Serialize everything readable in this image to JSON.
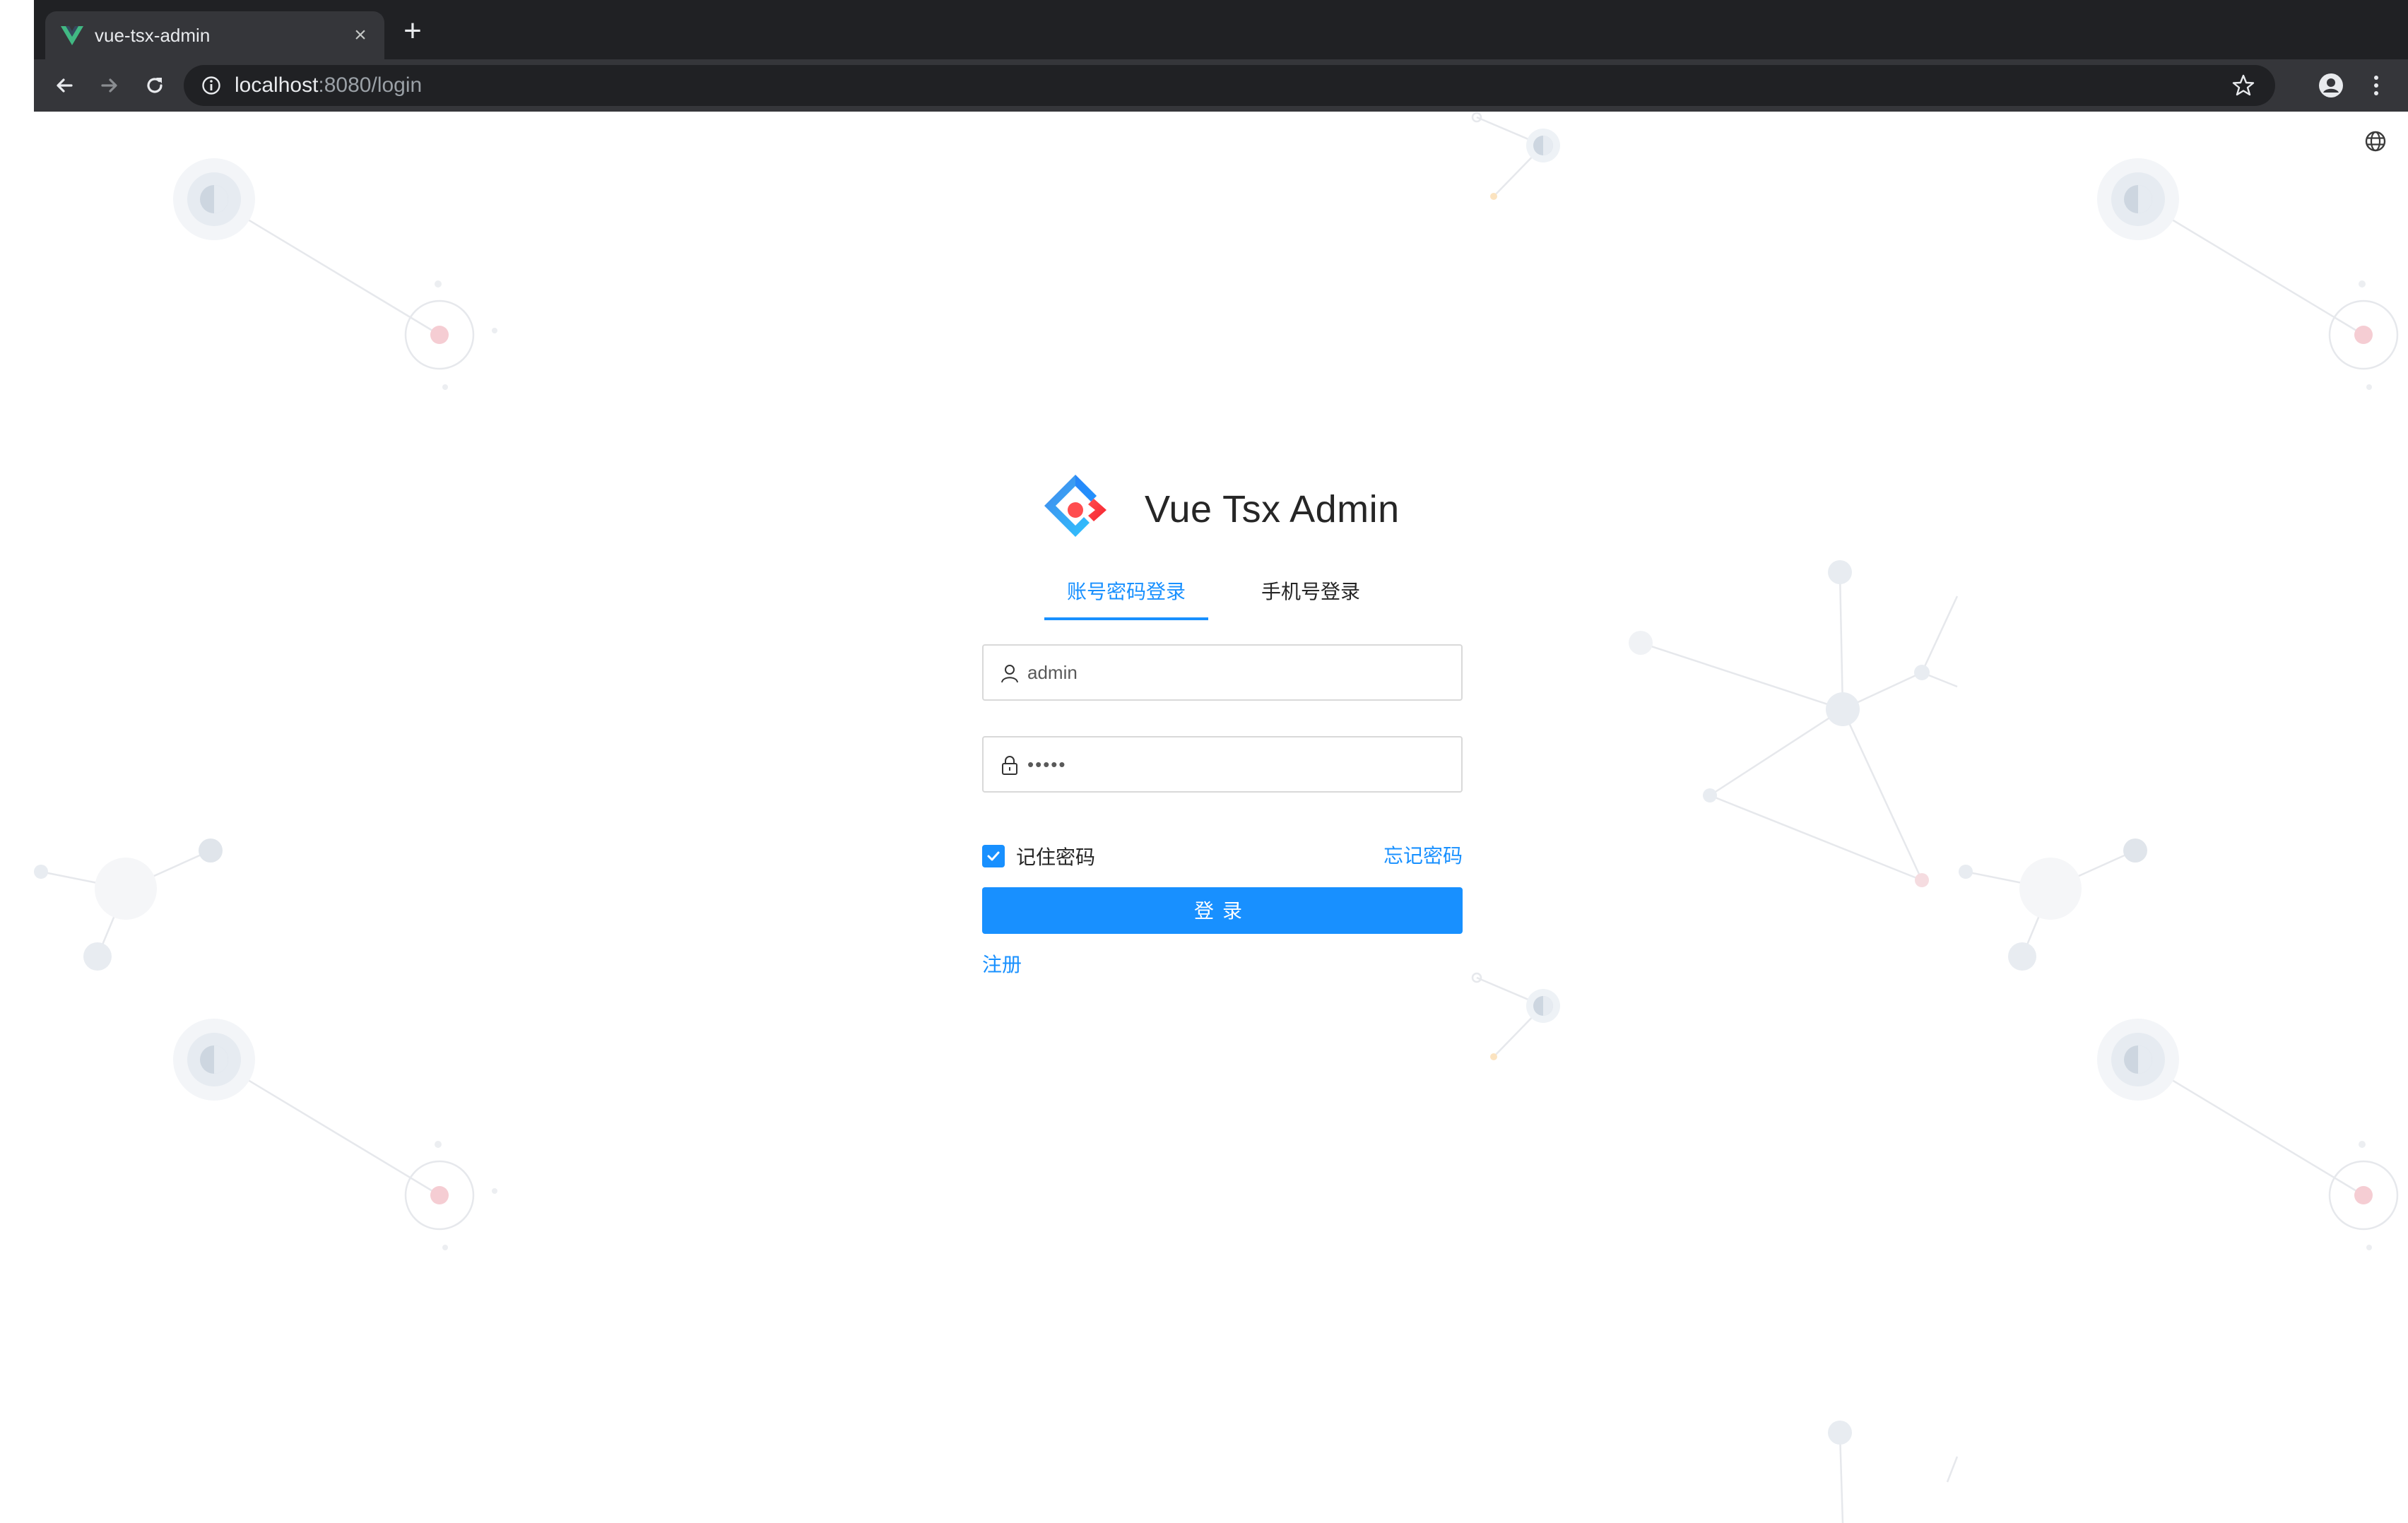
{
  "browser": {
    "tab_title": "vue-tsx-admin",
    "tab_close": "×",
    "new_tab": "+",
    "url_host": "localhost",
    "url_rest": ":8080/login"
  },
  "login": {
    "app_title": "Vue Tsx Admin",
    "tabs": [
      {
        "label": "账号密码登录",
        "active": true
      },
      {
        "label": "手机号登录",
        "active": false
      }
    ],
    "username": {
      "value": "admin",
      "placeholder": ""
    },
    "password": {
      "value": "admin",
      "placeholder": ""
    },
    "remember_label": "记住密码",
    "remember_checked": true,
    "forgot_label": "忘记密码",
    "submit_label": "登录",
    "register_label": "注册"
  },
  "colors": {
    "primary": "#1890ff",
    "tab_strip": "#202124",
    "toolbar": "#35363a",
    "text": "#262626",
    "border": "#d9d9d9"
  },
  "icons": {
    "favicon": "vue-logo-icon",
    "back": "arrow-left-icon",
    "forward": "arrow-right-icon",
    "reload": "reload-icon",
    "site_info": "info-icon",
    "bookmark": "star-icon",
    "profile": "account-circle-icon",
    "menu": "kebab-menu-icon",
    "language": "globe-icon",
    "username_prefix": "user-icon",
    "password_prefix": "lock-icon",
    "checkbox": "check-icon",
    "logo": "ant-design-logo-icon"
  }
}
